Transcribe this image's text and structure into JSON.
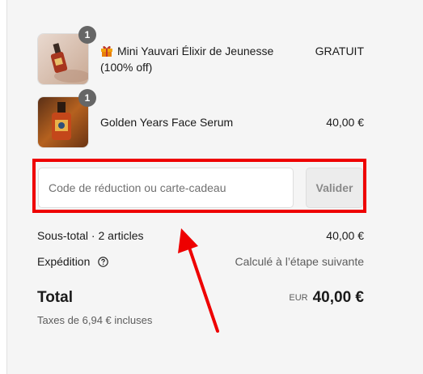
{
  "cart": {
    "items": [
      {
        "quantity": "1",
        "name_prefix_icon": "gift-icon",
        "name": "Mini Yauvari Élixir de Jeunesse (100% off)",
        "price": "GRATUIT"
      },
      {
        "quantity": "1",
        "name": "Golden Years Face Serum",
        "price": "40,00 €"
      }
    ]
  },
  "discount": {
    "placeholder": "Code de réduction ou carte-cadeau",
    "value": "",
    "apply_label": "Valider"
  },
  "summary": {
    "subtotal_label": "Sous-total · 2 articles",
    "subtotal_value": "40,00 €",
    "shipping_label": "Expédition",
    "shipping_help_icon": "question-circle-icon",
    "shipping_value": "Calculé à l’étape suivante",
    "total_label": "Total",
    "currency": "EUR",
    "total_value": "40,00 €",
    "taxes_note": "Taxes de 6,94 € incluses"
  },
  "annotation": {
    "color": "#ee0000"
  }
}
